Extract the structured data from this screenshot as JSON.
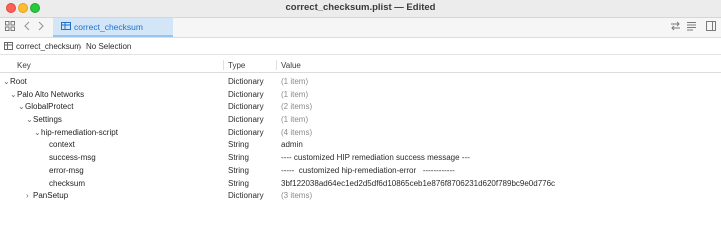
{
  "window": {
    "title": "correct_checksum.plist — Edited"
  },
  "toolbar": {
    "tab_label": "correct_checksum"
  },
  "pathbar": {
    "file": "correct_checksum",
    "separator": "〉",
    "selection": "No Selection"
  },
  "header": {
    "key": "Key",
    "type": "Type",
    "value": "Value"
  },
  "rows": [
    {
      "key": "Root",
      "type": "Dictionary",
      "value": "(1 item)",
      "disclosure": "open",
      "value_muted": true
    },
    {
      "key": "Palo Alto Networks",
      "type": "Dictionary",
      "value": "(1 item)",
      "disclosure": "open",
      "value_muted": true
    },
    {
      "key": "GlobalProtect",
      "type": "Dictionary",
      "value": "(2 items)",
      "disclosure": "open",
      "value_muted": true
    },
    {
      "key": "Settings",
      "type": "Dictionary",
      "value": "(1 item)",
      "disclosure": "open",
      "value_muted": true
    },
    {
      "key": "hip-remediation-script",
      "type": "Dictionary",
      "value": "(4 items)",
      "disclosure": "open",
      "value_muted": true
    },
    {
      "key": "context",
      "type": "String",
      "value": "admin",
      "disclosure": "none",
      "value_muted": false
    },
    {
      "key": "success-msg",
      "type": "String",
      "value": "---- customized HIP remediation success message ---",
      "disclosure": "none",
      "value_muted": false
    },
    {
      "key": "error-msg",
      "type": "String",
      "value": "-----  customized hip-remediation-error   ------------",
      "disclosure": "none",
      "value_muted": false
    },
    {
      "key": "checksum",
      "type": "String",
      "value": "3bf122038ad64ec1ed2d5df6d10865ceb1e876f8706231d620f789bc9e0d776c",
      "disclosure": "none",
      "value_muted": false
    },
    {
      "key": "PanSetup",
      "type": "Dictionary",
      "value": "(3 items)",
      "disclosure": "closed",
      "value_muted": true
    }
  ],
  "icons": {
    "grid": "sidebar-grid-icon",
    "back": "chevron-left-icon",
    "forward": "chevron-right-icon",
    "table": "table-icon",
    "swap": "swap-arrows-icon",
    "list": "list-format-icon",
    "inspector": "inspector-panel-icon"
  },
  "colors": {
    "tab_bg": "#d2e6f8",
    "tab_text": "#2270c9",
    "close": "#fe5f57",
    "minimize": "#febc2e",
    "zoom": "#28c840"
  }
}
